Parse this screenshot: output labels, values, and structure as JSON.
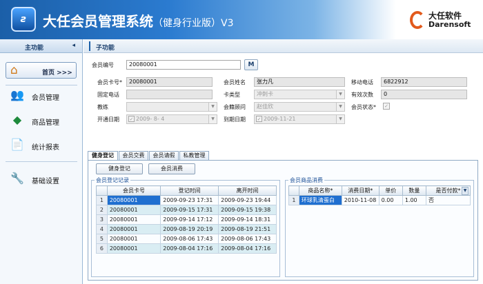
{
  "app": {
    "title": "大任会员管理系统",
    "subtitle": "（健身行业版）V3",
    "logo_text": "ƨ",
    "brand_cn": "大任软件",
    "brand_en": "Darensoft"
  },
  "sidebar": {
    "header": "主功能",
    "collapse_icon": "◂",
    "home_label": "首页 >>>",
    "items": [
      {
        "label": "会员管理",
        "icon": "members-icon",
        "glyph": "👥"
      },
      {
        "label": "商品管理",
        "icon": "products-icon",
        "glyph": "◆"
      },
      {
        "label": "统计报表",
        "icon": "report-icon",
        "glyph": "📄"
      },
      {
        "label": "基础设置",
        "icon": "settings-icon",
        "glyph": "🔧"
      }
    ]
  },
  "main": {
    "header": "子功能",
    "search": {
      "label": "会员编号",
      "value": "20080001",
      "button": "M"
    },
    "form": {
      "card_no": {
        "label": "会员卡号*",
        "value": "20080001"
      },
      "name": {
        "label": "会员姓名",
        "value": "张力凡"
      },
      "mobile": {
        "label": "移动电话",
        "value": "6822912"
      },
      "phone": {
        "label": "固定电话",
        "value": ""
      },
      "card_type": {
        "label": "卡类型",
        "value": "冲刺卡"
      },
      "valid_times": {
        "label": "有效次数",
        "value": "0"
      },
      "coach": {
        "label": "教练",
        "value": ""
      },
      "advisor": {
        "label": "会籍顾问",
        "value": "赵佳欣"
      },
      "status": {
        "label": "会员状态*",
        "checked": true
      },
      "open_date": {
        "label": "开通日期",
        "value": "2009- 8- 4",
        "checked": true
      },
      "expire_date": {
        "label": "到期日期",
        "value": "2009-11-21",
        "checked": true
      }
    },
    "tabs": [
      "健身登记",
      "会员交费",
      "会员请假",
      "私教管理"
    ],
    "buttons": {
      "checkin": "健身登记",
      "consume": "会员消费"
    },
    "checkin_group": {
      "title": "会员登记记录",
      "columns": [
        "",
        "会员卡号",
        "登记时间",
        "离开时间"
      ],
      "rows": [
        {
          "idx": "1",
          "card": "20080001",
          "in": "2009-09-23 17:31",
          "out": "2009-09-23 19:44"
        },
        {
          "idx": "2",
          "card": "20080001",
          "in": "2009-09-15 17:31",
          "out": "2009-09-15 19:38"
        },
        {
          "idx": "3",
          "card": "20080001",
          "in": "2009-09-14 17:12",
          "out": "2009-09-14 18:31"
        },
        {
          "idx": "4",
          "card": "20080001",
          "in": "2009-08-19 20:19",
          "out": "2009-08-19 21:51"
        },
        {
          "idx": "5",
          "card": "20080001",
          "in": "2009-08-06 17:43",
          "out": "2009-08-06 17:43"
        },
        {
          "idx": "6",
          "card": "20080001",
          "in": "2009-08-04 17:16",
          "out": "2009-08-04 17:16"
        }
      ]
    },
    "consume_group": {
      "title": "会员商品消费",
      "columns": [
        "",
        "商品名称*",
        "消费日期*",
        "单价",
        "数量",
        "是否付款*"
      ],
      "rows": [
        {
          "idx": "1",
          "product": "环球乳清蛋白",
          "date": "2010-11-08",
          "price": "0.00",
          "qty": "1.00",
          "paid": "否"
        }
      ]
    }
  }
}
